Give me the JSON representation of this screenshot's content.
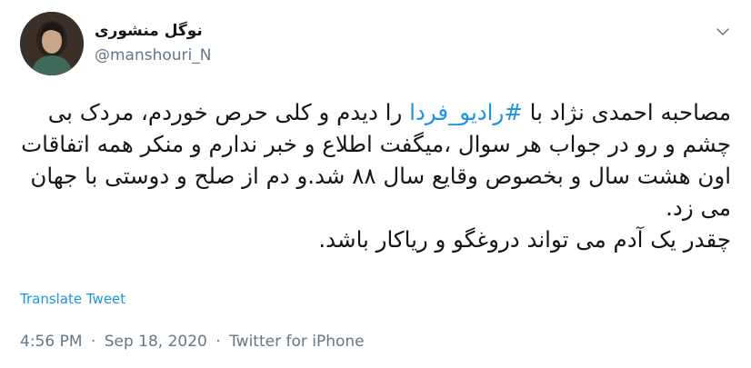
{
  "user": {
    "display_name": "نوگل منشوری",
    "handle": "@manshouri_N"
  },
  "tweet": {
    "text_before": "مصاحبه احمدی نژاد با ",
    "hashtag": "#رادیو_فردا",
    "text_after": " را دیدم و کلی حرص خوردم، مردک بی چشم و رو در جواب هر سوال ،میگفت اطلاع و خبر ندارم و منکر همه اتفاقات اون هشت سال و بخصوص وقایع سال ۸۸ شد.و دم از صلح و دوستی با جهان می زد.\nچقدر یک آدم می تواند دروغگو و ریاکار باشد."
  },
  "translate_label": "Translate Tweet",
  "meta": {
    "time": "4:56 PM",
    "date": "Sep 18, 2020",
    "separator": "·",
    "source": "Twitter for iPhone"
  },
  "icons": {
    "menu": "chevron-down-icon"
  },
  "colors": {
    "link": "#1b95e0",
    "secondary": "#657786",
    "text": "#14171a"
  }
}
